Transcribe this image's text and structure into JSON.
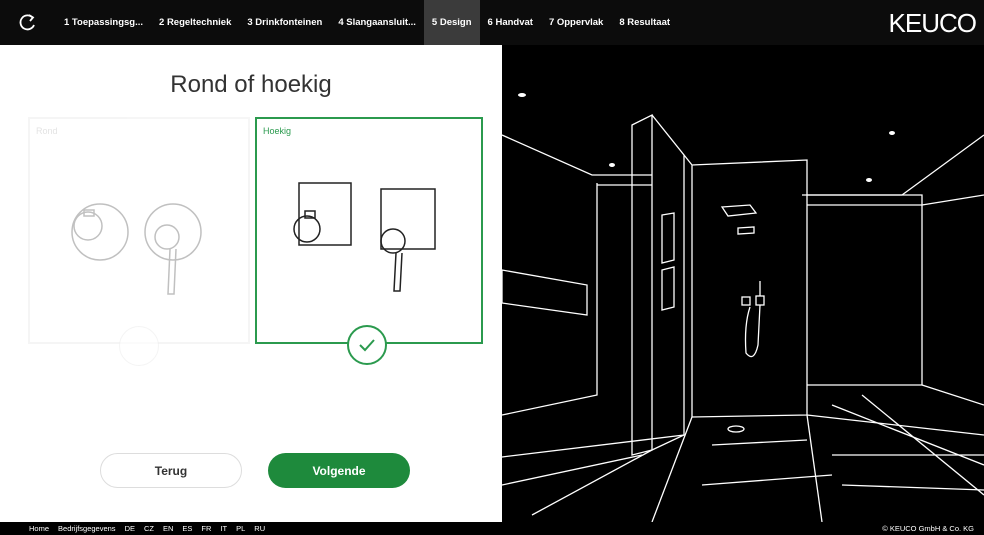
{
  "nav": {
    "steps": [
      {
        "label": "1 Toepassingsg..."
      },
      {
        "label": "2 Regeltechniek"
      },
      {
        "label": "3 Drinkfonteinen"
      },
      {
        "label": "4 Slangaansluit..."
      },
      {
        "label": "5 Design"
      },
      {
        "label": "6 Handvat"
      },
      {
        "label": "7 Oppervlak"
      },
      {
        "label": "8 Resultaat"
      }
    ],
    "active_step": 4,
    "logo": "KEUCO"
  },
  "main": {
    "title": "Rond of hoekig",
    "options": [
      {
        "label": "Rond",
        "selected": false
      },
      {
        "label": "Hoekig",
        "selected": true
      }
    ]
  },
  "buttons": {
    "back": "Terug",
    "next": "Volgende"
  },
  "footer": {
    "links": [
      "Home",
      "Bedrijfsgegevens",
      "DE",
      "CZ",
      "EN",
      "ES",
      "FR",
      "IT",
      "PL",
      "RU"
    ],
    "copyright": "© KEUCO GmbH & Co. KG"
  },
  "colors": {
    "accent": "#1e8a3c",
    "topbar": "#0c0c0c",
    "active_tab": "#3b3b3b"
  }
}
